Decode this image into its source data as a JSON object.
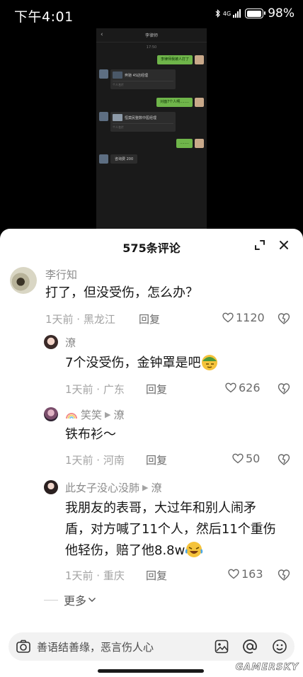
{
  "status_bar": {
    "time": "下午4:01",
    "network": "4G",
    "battery": "98%",
    "battery_level": 0.98
  },
  "chat_screenshot": {
    "contact": "李律师",
    "time": "17:50",
    "messages": [
      {
        "side": "right",
        "text": "李律师我被人打了"
      },
      {
        "side": "left",
        "type": "card",
        "title": "奔驰 4S店经理",
        "sub": "个人名片"
      },
      {
        "side": "right",
        "text": "对面7个人啊........"
      },
      {
        "side": "left",
        "type": "card",
        "title": "恒莫民整数中医经理",
        "sub": "个人名片"
      },
      {
        "side": "right",
        "text": "........"
      },
      {
        "side": "left",
        "text": "咨询费 200"
      }
    ]
  },
  "panel": {
    "title": "575条评论"
  },
  "comments": [
    {
      "name": "李行知",
      "text": "打了，但没受伤，怎么办？",
      "time_location": "1天前 · 黑龙江",
      "reply_label": "回复",
      "likes": "1120"
    },
    {
      "name": "潦",
      "text": "7个没受伤，金钟罩是吧",
      "time_location": "1天前 · 广东",
      "reply_label": "回复",
      "likes": "626"
    },
    {
      "name": "笑笑",
      "reply_to": "潦",
      "text": "铁布衫～",
      "time_location": "1天前 · 河南",
      "reply_label": "回复",
      "likes": "50"
    },
    {
      "name": "此女子没心没肺",
      "reply_to": "潦",
      "text_lines": [
        "我朋友的表哥，大过年和别人闹矛",
        "盾，对方喊了11个人，然后11个重伤",
        "他轻伤，赔了他8.8w"
      ],
      "time_location": "1天前 · 重庆",
      "reply_label": "回复",
      "likes": "163"
    }
  ],
  "more_label": "更多",
  "input_bar": {
    "placeholder": "善语结善缘，恶言伤人心"
  },
  "watermark": "GAMERSKY"
}
